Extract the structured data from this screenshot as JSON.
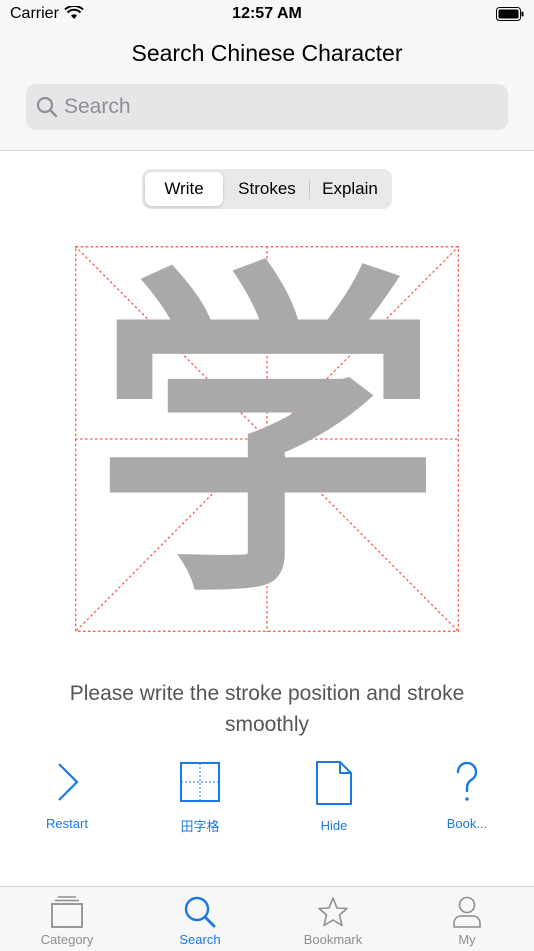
{
  "status_bar": {
    "carrier": "Carrier",
    "time": "12:57 AM"
  },
  "header": {
    "title": "Search Chinese Character"
  },
  "search": {
    "placeholder": "Search",
    "value": ""
  },
  "segments": [
    {
      "label": "Write",
      "selected": true
    },
    {
      "label": "Strokes",
      "selected": false
    },
    {
      "label": "Explain",
      "selected": false
    }
  ],
  "character": {
    "glyph": "学"
  },
  "instruction": "Please write the stroke position and stroke smoothly",
  "toolbar": [
    {
      "label": "Restart",
      "icon": "chevron-right-icon"
    },
    {
      "label": "田字格",
      "icon": "grid-icon"
    },
    {
      "label": "Hide",
      "icon": "document-icon"
    },
    {
      "label": "Book...",
      "icon": "question-mark-icon"
    }
  ],
  "tabs": [
    {
      "label": "Category",
      "icon": "tray-icon",
      "active": false
    },
    {
      "label": "Search",
      "icon": "search-icon",
      "active": true
    },
    {
      "label": "Bookmark",
      "icon": "star-icon",
      "active": false
    },
    {
      "label": "My",
      "icon": "person-icon",
      "active": false
    }
  ],
  "colors": {
    "accent": "#1a78e5",
    "grid_line": "#ff5a4f",
    "glyph": "#a9a9a9",
    "bar_background": "#f7f7f7"
  }
}
